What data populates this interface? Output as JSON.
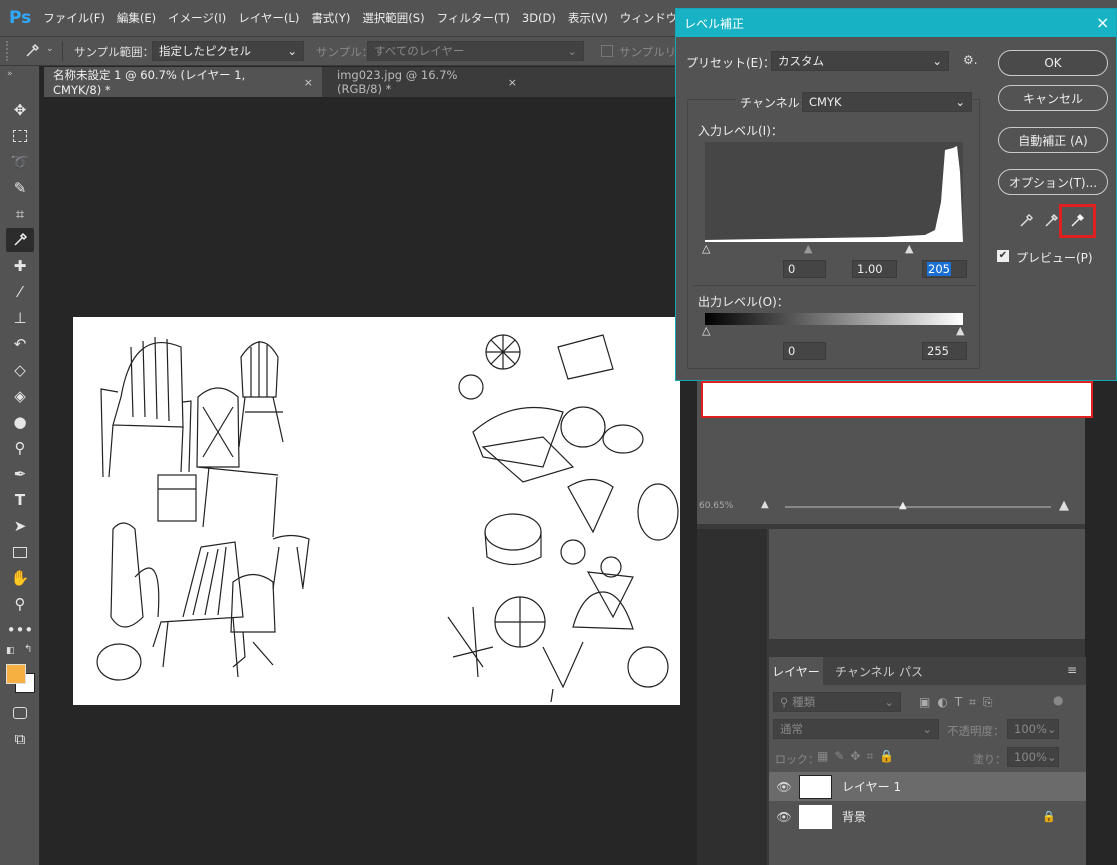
{
  "app": {
    "logo": "Ps"
  },
  "menubar": {
    "items": [
      "ファイル(F)",
      "編集(E)",
      "イメージ(I)",
      "レイヤー(L)",
      "書式(Y)",
      "選択範囲(S)",
      "フィルター(T)",
      "3D(D)",
      "表示(V)",
      "ウィンドウ(W)"
    ]
  },
  "optionsbar": {
    "sample_label": "サンプル範囲：",
    "sample_value": "指定したピクセル",
    "sample2_label": "サンプル：",
    "sample2_value": "すべてのレイヤー",
    "sample_ring": "サンプルリン"
  },
  "tabs": [
    {
      "label": "名称未設定 1 @ 60.7% (レイヤー 1, CMYK/8) *",
      "close": "×"
    },
    {
      "label": "img023.jpg @ 16.7% (RGB/8) *",
      "close": "×"
    }
  ],
  "tools": [
    "move-icon",
    "marquee-icon",
    "lasso-icon",
    "quick-select-icon",
    "crop-icon",
    "eyedropper-icon",
    "healing-icon",
    "brush-icon",
    "stamp-icon",
    "history-brush-icon",
    "eraser-icon",
    "paint-bucket-icon",
    "blur-icon",
    "dodge-icon",
    "pen-icon",
    "type-icon",
    "path-select-icon",
    "rectangle-icon",
    "hand-icon",
    "zoom-icon",
    "more-icon"
  ],
  "colors": {
    "foreground": "#f5b041",
    "background": "#ffffff",
    "dialog_title_bg": "#17b3c4",
    "highlight_red": "#e02020"
  },
  "dialog": {
    "title": "レベル補正",
    "close": "×",
    "preset_label": "プリセット(E)：",
    "preset_value": "カスタム",
    "channel_label": "チャンネル：",
    "channel_value": "CMYK",
    "input_label": "入力レベル(I)：",
    "input_black": "0",
    "input_gamma": "1.00",
    "input_white": "205",
    "output_label": "出力レベル(O)：",
    "output_black": "0",
    "output_white": "255",
    "buttons": {
      "ok": "OK",
      "cancel": "キャンセル",
      "auto": "自動補正 (A)",
      "options": "オプション(T)..."
    },
    "preview_label": "プレビュー(P)",
    "preview_checked": true
  },
  "navigator": {
    "zoom": "60.65%"
  },
  "layers_panel": {
    "tabs": [
      "レイヤー",
      "チャンネル",
      "パス"
    ],
    "filter_label": "種類",
    "blend_mode": "通常",
    "opacity_label": "不透明度：",
    "opacity_value": "100%",
    "lock_label": "ロック：",
    "fill_label": "塗り：",
    "fill_value": "100%",
    "layers": [
      {
        "name": "レイヤー 1"
      },
      {
        "name": "背景"
      }
    ]
  }
}
